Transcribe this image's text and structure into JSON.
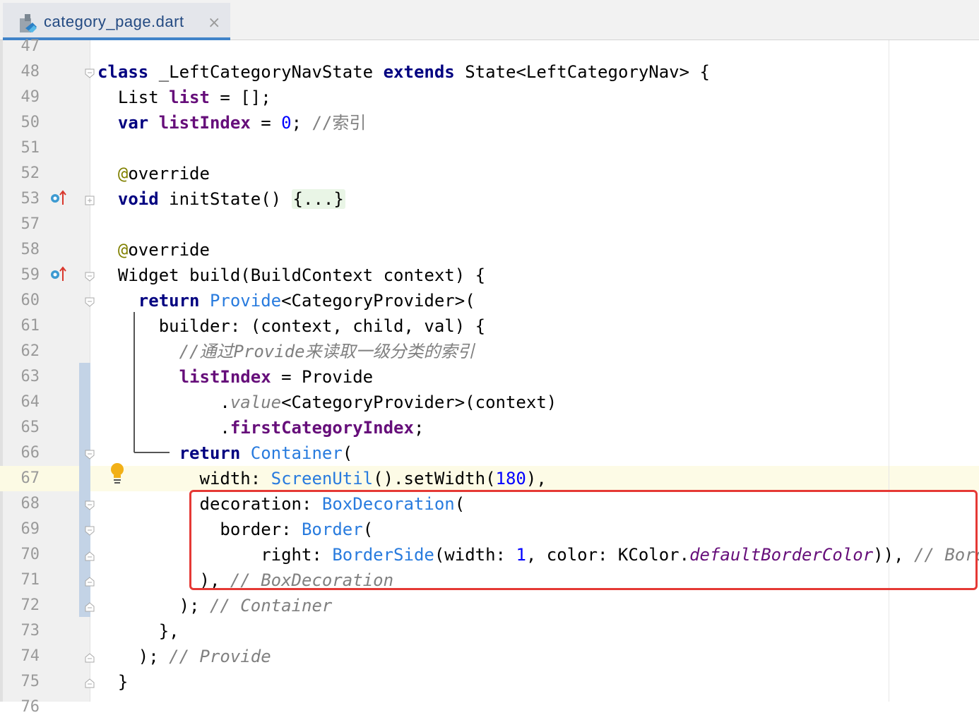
{
  "editor": {
    "tab": {
      "filename": "category_page.dart",
      "close": "×"
    },
    "line_numbers": [
      "47",
      "48",
      "49",
      "50",
      "51",
      "52",
      "53",
      "57",
      "58",
      "59",
      "60",
      "61",
      "62",
      "63",
      "64",
      "65",
      "66",
      "67",
      "68",
      "69",
      "70",
      "71",
      "72",
      "73",
      "74",
      "75",
      "76"
    ],
    "lines": [
      [],
      [
        {
          "t": "class",
          "c": "kw"
        },
        {
          "t": " _LeftCategoryNavState "
        },
        {
          "t": "extends",
          "c": "kw"
        },
        {
          "t": " State<LeftCategoryNav> {"
        }
      ],
      [
        {
          "t": "  List "
        },
        {
          "t": "list",
          "c": "fld"
        },
        {
          "t": " = [];"
        }
      ],
      [
        {
          "t": "  "
        },
        {
          "t": "var",
          "c": "kw"
        },
        {
          "t": " "
        },
        {
          "t": "listIndex",
          "c": "fld"
        },
        {
          "t": " = "
        },
        {
          "t": "0",
          "c": "num"
        },
        {
          "t": "; "
        },
        {
          "t": "//索引",
          "c": "cmtn"
        }
      ],
      [],
      [
        {
          "t": "  "
        },
        {
          "t": "@",
          "c": "ann"
        },
        {
          "t": "override"
        }
      ],
      [
        {
          "t": "  "
        },
        {
          "t": "void",
          "c": "kw"
        },
        {
          "t": " initState() "
        },
        {
          "t": "{...}",
          "c": "fold-region"
        }
      ],
      [],
      [
        {
          "t": "  "
        },
        {
          "t": "@",
          "c": "ann"
        },
        {
          "t": "override"
        }
      ],
      [
        {
          "t": "  Widget build(BuildContext context) {"
        }
      ],
      [
        {
          "t": "    "
        },
        {
          "t": "return",
          "c": "kw"
        },
        {
          "t": " "
        },
        {
          "t": "Provide",
          "c": "cls"
        },
        {
          "t": "<CategoryProvider>("
        }
      ],
      [
        {
          "t": "      builder: (context, child, val) {"
        }
      ],
      [
        {
          "t": "        "
        },
        {
          "t": "//通过Provide来读取一级分类的索引",
          "c": "cmt"
        }
      ],
      [
        {
          "t": "        "
        },
        {
          "t": "listIndex",
          "c": "fld"
        },
        {
          "t": " = Provide"
        }
      ],
      [
        {
          "t": "            ."
        },
        {
          "t": "value",
          "c": "cmt"
        },
        {
          "t": "<CategoryProvider>(context)"
        }
      ],
      [
        {
          "t": "            ."
        },
        {
          "t": "firstCategoryIndex",
          "c": "fld"
        },
        {
          "t": ";"
        }
      ],
      [
        {
          "t": "        "
        },
        {
          "t": "return",
          "c": "kw"
        },
        {
          "t": " "
        },
        {
          "t": "Container",
          "c": "cls"
        },
        {
          "t": "("
        }
      ],
      [
        {
          "t": "          width: "
        },
        {
          "t": "ScreenUtil",
          "c": "cls"
        },
        {
          "t": "().setWidth("
        },
        {
          "t": "180",
          "c": "num"
        },
        {
          "t": "),"
        }
      ],
      [
        {
          "t": "          decoration: "
        },
        {
          "t": "BoxDecoration",
          "c": "cls"
        },
        {
          "t": "("
        }
      ],
      [
        {
          "t": "            border: "
        },
        {
          "t": "Border",
          "c": "cls"
        },
        {
          "t": "("
        }
      ],
      [
        {
          "t": "                right: "
        },
        {
          "t": "BorderSide",
          "c": "cls"
        },
        {
          "t": "(width: "
        },
        {
          "t": "1",
          "c": "num"
        },
        {
          "t": ", color: KColor."
        },
        {
          "t": "defaultBorderColor",
          "c": "italf"
        },
        {
          "t": ")), "
        },
        {
          "t": "// Border",
          "c": "cmt"
        }
      ],
      [
        {
          "t": "          ), "
        },
        {
          "t": "// BoxDecoration",
          "c": "cmt"
        }
      ],
      [
        {
          "t": "        ); "
        },
        {
          "t": "// Container",
          "c": "cmt"
        }
      ],
      [
        {
          "t": "      },"
        }
      ],
      [
        {
          "t": "    ); "
        },
        {
          "t": "// Provide",
          "c": "cmt"
        }
      ],
      [
        {
          "t": "  }"
        }
      ],
      []
    ],
    "gutter_icons": [
      {
        "line": "53",
        "icon": "override-up-arrow-icon"
      },
      {
        "line": "59",
        "icon": "override-up-arrow-icon"
      },
      {
        "line": "67",
        "icon": "lightbulb-intention-icon"
      }
    ],
    "colors": {
      "keyword": "#000080",
      "field": "#660e7a",
      "number": "#0000ff",
      "class": "#287bde",
      "comment": "#808080",
      "annotation": "#808000",
      "highlight_box": "#e53935",
      "tab_underline": "#4083c9"
    }
  }
}
